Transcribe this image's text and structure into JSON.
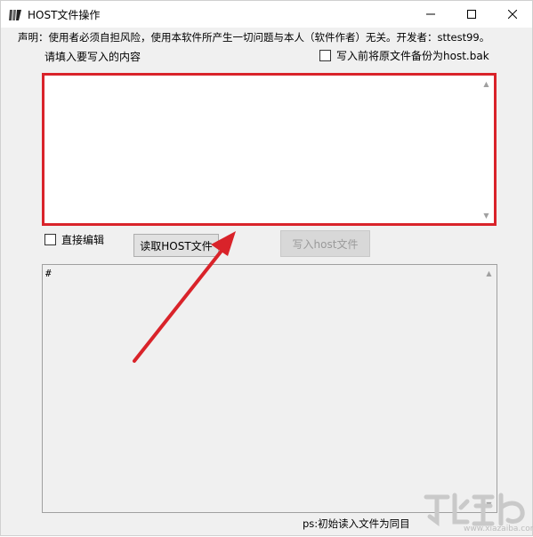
{
  "window": {
    "title": "HOST文件操作",
    "controls": {
      "minimize": "minimize-icon",
      "maximize": "maximize-icon",
      "close": "close-icon"
    }
  },
  "declaration": "声明：使用者必须自担风险，使用本软件所产生一切问题与本人（软件作者）无关。开发者：sttest99。",
  "input_section": {
    "label": "请填入要写入的内容",
    "backup_checkbox_label": "写入前将原文件备份为host.bak",
    "backup_checked": false,
    "value": ""
  },
  "controls": {
    "direct_edit_label": "直接编辑",
    "direct_edit_checked": false,
    "read_button": "读取HOST文件",
    "write_button": "写入host文件"
  },
  "output_section": {
    "text": "#"
  },
  "footer": {
    "ps_note": "ps:初始读入文件为同目"
  },
  "watermark": {
    "text": "www.xiazaiba.com"
  },
  "colors": {
    "highlight_border": "#d9232a",
    "annotation_arrow": "#d9232a",
    "window_bg": "#f0f0f0"
  }
}
